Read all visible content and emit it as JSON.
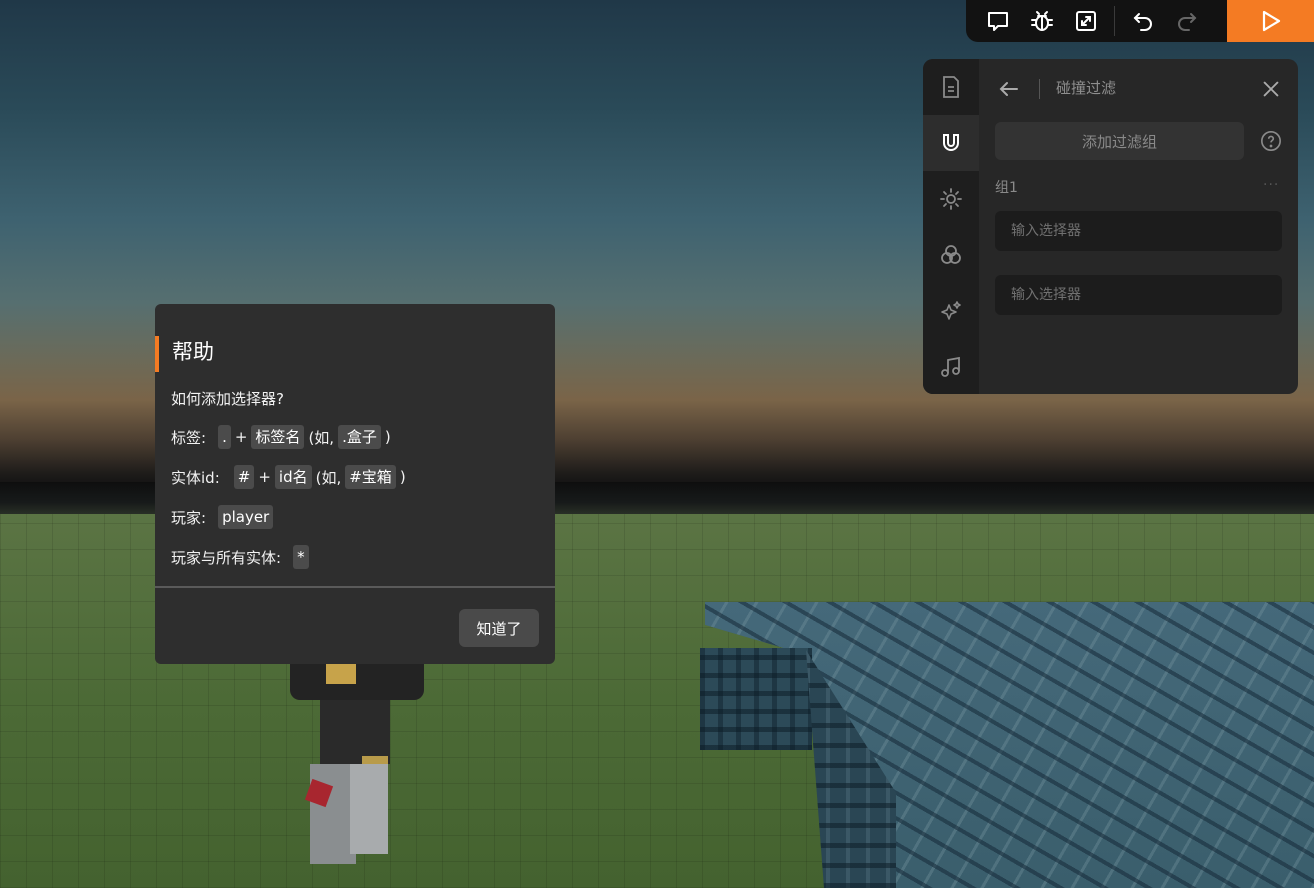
{
  "toolbar": {
    "icons": [
      "comment-icon",
      "bug-icon",
      "resize-icon",
      "undo-icon",
      "redo-icon",
      "play-icon"
    ],
    "play_color": "#f47b23"
  },
  "panel": {
    "sidebar_icons": [
      "document-icon",
      "magnet-icon",
      "sun-icon",
      "circles-icon",
      "sparkle-icon",
      "music-icon"
    ],
    "title": "碰撞过滤",
    "add_group_label": "添加过滤组",
    "group_label": "组1",
    "group_more": "···",
    "selector_placeholder_1": "输入选择器",
    "selector_placeholder_2": "输入选择器"
  },
  "dialog": {
    "title": "帮助",
    "question": "如何添加选择器?",
    "tag": {
      "label": "标签:",
      "prefix": ".",
      "plus": "+",
      "name": "标签名",
      "example_open": "(如,",
      "example": ".盒子",
      "example_close": ")"
    },
    "entity": {
      "label": "实体id:",
      "prefix": "#",
      "plus": "+",
      "name": "id名",
      "example_open": "(如,",
      "example": "#宝箱",
      "example_close": ")"
    },
    "player": {
      "label": "玩家:",
      "code": "player"
    },
    "all": {
      "label": "玩家与所有实体:",
      "code": "*"
    },
    "ok_label": "知道了",
    "accent_color": "#f47b23"
  }
}
